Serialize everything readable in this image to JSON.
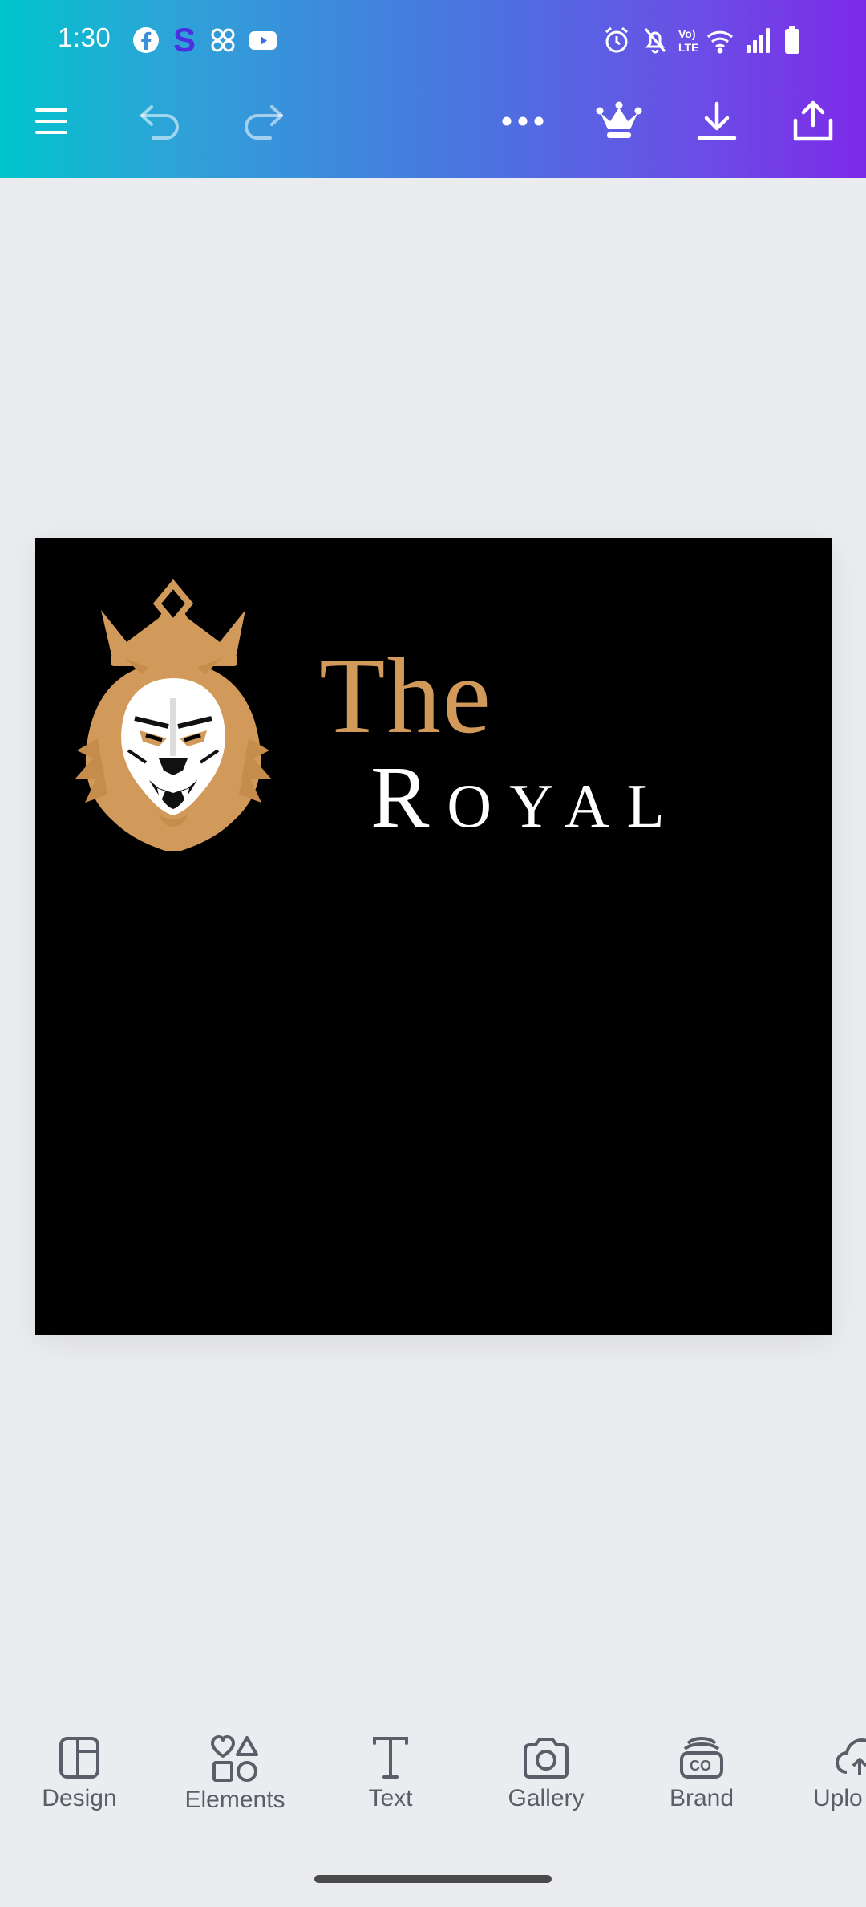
{
  "status_bar": {
    "time": "1:30",
    "app_icons": [
      "facebook-icon",
      "s-app-icon",
      "pinwheel-icon",
      "youtube-icon"
    ],
    "right_icons": [
      "alarm-icon",
      "mute-icon",
      "volte-icon",
      "wifi-icon",
      "signal-icon",
      "battery-icon"
    ],
    "volte_text": "Vo)\nLTE"
  },
  "toolbar": {
    "buttons": [
      "menu-icon",
      "undo-icon",
      "redo-icon",
      "more-icon",
      "crown-icon",
      "download-icon",
      "share-icon"
    ]
  },
  "design": {
    "title_line1": "The",
    "title_line2": "Royal",
    "colors": {
      "background": "#000000",
      "gold": "#d19a5b",
      "white": "#ffffff"
    }
  },
  "bottom_nav": {
    "items": [
      {
        "label": "Design",
        "icon": "design-icon"
      },
      {
        "label": "Elements",
        "icon": "elements-icon"
      },
      {
        "label": "Text",
        "icon": "text-icon"
      },
      {
        "label": "Gallery",
        "icon": "camera-icon"
      },
      {
        "label": "Brand",
        "icon": "brand-icon"
      },
      {
        "label": "Uplo",
        "icon": "upload-icon"
      }
    ]
  },
  "colors": {
    "header_gradient_start": "#00c4cc",
    "header_gradient_end": "#7d2ae8",
    "canvas_bg": "#ebecf0",
    "nav_text": "#5a5e66"
  }
}
